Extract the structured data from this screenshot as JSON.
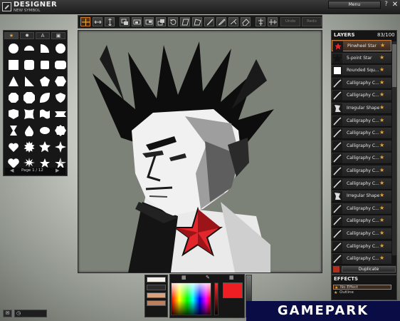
{
  "app": {
    "title": "DESIGNER",
    "subtitle": "NEW SYMBOL"
  },
  "topbar": {
    "menu_label": "Menu",
    "help_icon": "question-icon",
    "close_icon": "close-icon"
  },
  "toolbar": {
    "tools": [
      "move-icon",
      "flip-horizontal-icon",
      "flip-vertical-icon",
      "arrange-front-icon",
      "arrange-forward-icon",
      "arrange-backward-icon",
      "arrange-back-icon",
      "rotate-icon",
      "skew-icon",
      "distort-icon",
      "brush-icon",
      "pen-icon",
      "gradient-icon",
      "eraser-icon",
      "align-vertical-icon",
      "align-horizontal-icon"
    ],
    "undo_label": "Undo",
    "redo_label": "Redo"
  },
  "left_panel": {
    "tabs": [
      "star-tab-icon",
      "badge-tab-icon",
      "A",
      "image-tab-icon"
    ],
    "page_label": "Page 1 / 12",
    "shapes": [
      "circle",
      "half-circle",
      "quarter-circle",
      "circle",
      "square",
      "rounded-square",
      "rounded-square-small",
      "wide-rounded-square",
      "triangle",
      "right-triangle",
      "pentagon",
      "hexagon",
      "octagon",
      "rounded-octagon",
      "leaf",
      "shield",
      "badge",
      "pillow",
      "wave",
      "banner",
      "hourglass",
      "drop",
      "lemon",
      "wavy-circle",
      "heart",
      "spiky-circle",
      "star",
      "sparkle",
      "heart-alt",
      "burst",
      "star-alt",
      "pinwheel"
    ]
  },
  "layers": {
    "title": "LAYERS",
    "count": "83/100",
    "items": [
      {
        "name": "Pinwheel Star",
        "selected": true,
        "thumb": "pinwheel"
      },
      {
        "name": "5-point Star",
        "selected": false,
        "thumb": "star"
      },
      {
        "name": "Rounded Squ...",
        "selected": false,
        "thumb": "white-square"
      },
      {
        "name": "Calligraphy C...",
        "selected": false,
        "thumb": "stroke"
      },
      {
        "name": "Calligraphy C...",
        "selected": false,
        "thumb": "stroke"
      },
      {
        "name": "Irregular Shape",
        "selected": false,
        "thumb": "irregular"
      },
      {
        "name": "Calligraphy C...",
        "selected": false,
        "thumb": "stroke"
      },
      {
        "name": "Calligraphy C...",
        "selected": false,
        "thumb": "stroke"
      },
      {
        "name": "Calligraphy C...",
        "selected": false,
        "thumb": "stroke"
      },
      {
        "name": "Calligraphy C...",
        "selected": false,
        "thumb": "stroke"
      },
      {
        "name": "Calligraphy C...",
        "selected": false,
        "thumb": "stroke"
      },
      {
        "name": "Calligraphy C...",
        "selected": false,
        "thumb": "stroke"
      },
      {
        "name": "Irregular Shape",
        "selected": false,
        "thumb": "irregular"
      },
      {
        "name": "Calligraphy C...",
        "selected": false,
        "thumb": "stroke"
      },
      {
        "name": "Calligraphy C...",
        "selected": false,
        "thumb": "stroke"
      },
      {
        "name": "Calligraphy C...",
        "selected": false,
        "thumb": "stroke"
      },
      {
        "name": "Calligraphy C...",
        "selected": false,
        "thumb": "stroke"
      },
      {
        "name": "Calligraphy C...",
        "selected": false,
        "thumb": "stroke"
      }
    ],
    "duplicate_label": "Duplicate"
  },
  "effects": {
    "title": "EFFECTS",
    "items": [
      "No Effect",
      "Outline"
    ]
  },
  "colors": {
    "current": "#ee1e22",
    "swatches": [
      "#f4f1ea",
      "#2b2b2b",
      "#d9a27f",
      "#b8805e"
    ],
    "accent": "#d47a2a"
  },
  "watermark": "GAMEPARK"
}
